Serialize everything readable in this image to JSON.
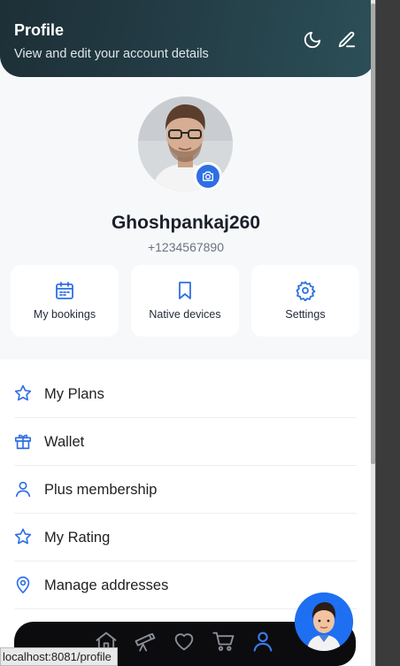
{
  "header": {
    "title": "Profile",
    "subtitle": "View and edit your account details",
    "icons": [
      "moon-icon",
      "pencil-icon"
    ]
  },
  "profile": {
    "username": "Ghoshpankaj260",
    "phone": "+1234567890"
  },
  "quick_actions": [
    {
      "label": "My bookings",
      "icon": "calendar-icon"
    },
    {
      "label": "Native devices",
      "icon": "bookmark-icon"
    },
    {
      "label": "Settings",
      "icon": "gear-icon"
    }
  ],
  "menu": [
    {
      "label": "My Plans",
      "icon": "star-icon"
    },
    {
      "label": "Wallet",
      "icon": "gift-icon"
    },
    {
      "label": "Plus membership",
      "icon": "user-icon"
    },
    {
      "label": "My Rating",
      "icon": "star-icon"
    },
    {
      "label": "Manage addresses",
      "icon": "map-pin-icon"
    }
  ],
  "tabbar": [
    "home-icon",
    "telescope-icon",
    "heart-icon",
    "cart-icon",
    "user-icon"
  ],
  "status_url": "localhost:8081/profile",
  "colors": {
    "accent": "#2f6fe4",
    "header": "#233c45",
    "tabbar": "#0c0c0e"
  }
}
